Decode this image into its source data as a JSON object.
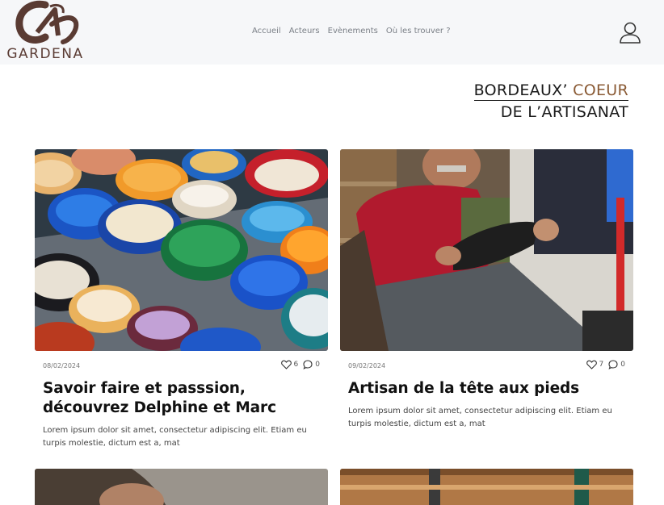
{
  "brand": {
    "name": "GARDENA"
  },
  "nav": {
    "items": [
      {
        "label": "Accueil"
      },
      {
        "label": "Acteurs"
      },
      {
        "label": "Evènements"
      },
      {
        "label": "Où les trouver ?"
      }
    ]
  },
  "hero": {
    "line1_part1": "BORDEAUX’ ",
    "line1_accent": "COEUR",
    "line2": "DE L’ARTISANAT"
  },
  "articles": [
    {
      "date": "08/02/2024",
      "likes": "6",
      "comments": "0",
      "title": "Savoir faire et passsion, découvrez Delphine et Marc",
      "excerpt": "Lorem ipsum dolor sit amet, consectetur adipiscing elit. Etiam eu turpis molestie, dictum est a, mat"
    },
    {
      "date": "09/02/2024",
      "likes": "7",
      "comments": "0",
      "title": "Artisan de la tête aux pieds",
      "excerpt": "Lorem ipsum dolor sit amet, consectetur adipiscing elit. Etiam eu turpis molestie, dictum est a, mat"
    }
  ],
  "colors": {
    "brand_brown": "#5a3b33",
    "accent": "#8a5a34",
    "header_bg": "#f6f7f9"
  },
  "icons": [
    "logo",
    "user-icon",
    "heart-icon",
    "comment-icon"
  ]
}
